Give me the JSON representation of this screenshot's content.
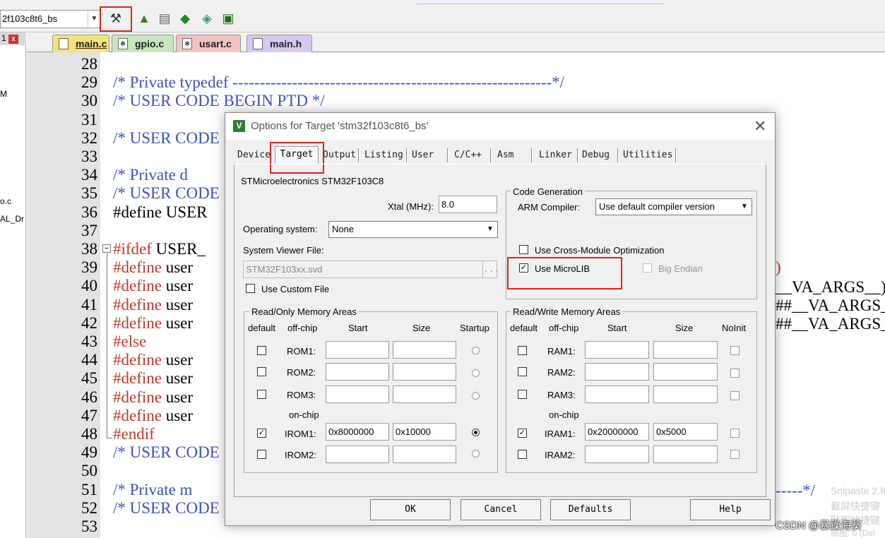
{
  "toolbar": {
    "target_name": "2f103c8t6_bs",
    "icons": [
      "options-for-target-icon",
      "manage-components-icon",
      "select-packs-icon",
      "debug-diamond-icon",
      "download-icon",
      "pack-installer-icon"
    ]
  },
  "left_panel": {
    "close_symbol": "x",
    "items": [
      "1",
      "M",
      "o.c",
      "AL_Dr"
    ]
  },
  "file_tabs": [
    {
      "label": "main.c",
      "active": true,
      "color": "#f6e27a"
    },
    {
      "label": "gpio.c",
      "active": false,
      "color": "#c8e6c0"
    },
    {
      "label": "usart.c",
      "active": false,
      "color": "#f4c2c2"
    },
    {
      "label": "main.h",
      "active": false,
      "color": "#d6c8f0"
    }
  ],
  "editor": {
    "lines": [
      {
        "n": "28",
        "segments": []
      },
      {
        "n": "29",
        "segments": [
          {
            "c": "cm",
            "t": "/* Private typedef -----------------------------------------------------------*/"
          }
        ]
      },
      {
        "n": "30",
        "segments": [
          {
            "c": "cm",
            "t": "/* USER CODE BEGIN PTD */"
          }
        ]
      },
      {
        "n": "31",
        "segments": []
      },
      {
        "n": "32",
        "segments": [
          {
            "c": "cm",
            "t": "/* USER CODE"
          }
        ]
      },
      {
        "n": "33",
        "segments": []
      },
      {
        "n": "34",
        "segments": [
          {
            "c": "cm",
            "t": "/* Private d"
          },
          {
            "c": "cm",
            "t": "                                                            -----*/"
          }
        ]
      },
      {
        "n": "35",
        "segments": [
          {
            "c": "cm",
            "t": "/* USER CODE"
          }
        ]
      },
      {
        "n": "36",
        "segments": [
          {
            "c": "tx",
            "t": "#define USER"
          }
        ]
      },
      {
        "n": "37",
        "segments": []
      },
      {
        "n": "38",
        "segments": [
          {
            "c": "pp",
            "t": "#ifdef"
          },
          {
            "c": "tx",
            "t": " USER_"
          }
        ]
      },
      {
        "n": "39",
        "segments": [
          {
            "c": "pp",
            "t": "#define"
          },
          {
            "c": "tx",
            "t": " user"
          }
        ]
      },
      {
        "n": "40",
        "segments": [
          {
            "c": "pp",
            "t": "#define"
          },
          {
            "c": "tx",
            "t": " user"
          }
        ]
      },
      {
        "n": "41",
        "segments": [
          {
            "c": "pp",
            "t": "#define"
          },
          {
            "c": "tx",
            "t": " user"
          }
        ]
      },
      {
        "n": "42",
        "segments": [
          {
            "c": "pp",
            "t": "#define"
          },
          {
            "c": "tx",
            "t": " user"
          }
        ]
      },
      {
        "n": "43",
        "segments": [
          {
            "c": "pp",
            "t": "#else"
          }
        ]
      },
      {
        "n": "44",
        "segments": [
          {
            "c": "pp",
            "t": "#define"
          },
          {
            "c": "tx",
            "t": " user"
          }
        ]
      },
      {
        "n": "45",
        "segments": [
          {
            "c": "pp",
            "t": "#define"
          },
          {
            "c": "tx",
            "t": " user"
          }
        ]
      },
      {
        "n": "46",
        "segments": [
          {
            "c": "pp",
            "t": "#define"
          },
          {
            "c": "tx",
            "t": " user"
          }
        ]
      },
      {
        "n": "47",
        "segments": [
          {
            "c": "pp",
            "t": "#define"
          },
          {
            "c": "tx",
            "t": " user"
          }
        ]
      },
      {
        "n": "48",
        "segments": [
          {
            "c": "pp",
            "t": "#endif"
          }
        ]
      },
      {
        "n": "49",
        "segments": [
          {
            "c": "cm",
            "t": "/* USER CODE"
          }
        ]
      },
      {
        "n": "50",
        "segments": []
      },
      {
        "n": "51",
        "segments": [
          {
            "c": "cm",
            "t": "/* Private m"
          }
        ]
      },
      {
        "n": "52",
        "segments": [
          {
            "c": "cm",
            "t": "/* USER CODE"
          }
        ]
      },
      {
        "n": "53",
        "segments": []
      }
    ],
    "right_fragments": {
      "paren": ")",
      "va1": "__VA_ARGS__)",
      "va2": "##__VA_ARGS_",
      "va3": "##__VA_ARGS_",
      "end51": "-----*/"
    }
  },
  "dialog": {
    "title": "Options for Target 'stm32f103c8t6_bs'",
    "close": "✕",
    "tabs": [
      "Device",
      "Target",
      "Output",
      "Listing",
      "User",
      "C/C++",
      "Asm",
      "Linker",
      "Debug",
      "Utilities"
    ],
    "active_tab": "Target",
    "device_name": "STMicroelectronics STM32F103C8",
    "xtal_label": "Xtal (MHz):",
    "xtal_value": "8.0",
    "os_label": "Operating system:",
    "os_value": "None",
    "svd_label": "System Viewer File:",
    "svd_value": "STM32F103xx.svd",
    "svd_browse": "...",
    "custom_file_label": "Use Custom File",
    "code_gen": {
      "title": "Code Generation",
      "compiler_label": "ARM Compiler:",
      "compiler_value": "Use default compiler version",
      "cross_module_label": "Use Cross-Module Optimization",
      "microlib_label": "Use MicroLIB",
      "microlib_checked": true,
      "big_endian_label": "Big Endian"
    },
    "ro_memory": {
      "title": "Read/Only Memory Areas",
      "headers": [
        "default",
        "off-chip",
        "Start",
        "Size",
        "Startup"
      ],
      "offchip_rows": [
        {
          "label": "ROM1:",
          "start": "",
          "size": ""
        },
        {
          "label": "ROM2:",
          "start": "",
          "size": ""
        },
        {
          "label": "ROM3:",
          "start": "",
          "size": ""
        }
      ],
      "onchip_label": "on-chip",
      "onchip_rows": [
        {
          "label": "IROM1:",
          "start": "0x8000000",
          "size": "0x10000",
          "default": true,
          "startup": true
        },
        {
          "label": "IROM2:",
          "start": "",
          "size": "",
          "default": false,
          "startup": false
        }
      ]
    },
    "rw_memory": {
      "title": "Read/Write Memory Areas",
      "headers": [
        "default",
        "off-chip",
        "Start",
        "Size",
        "NoInit"
      ],
      "offchip_rows": [
        {
          "label": "RAM1:",
          "start": "",
          "size": ""
        },
        {
          "label": "RAM2:",
          "start": "",
          "size": ""
        },
        {
          "label": "RAM3:",
          "start": "",
          "size": ""
        }
      ],
      "onchip_label": "on-chip",
      "onchip_rows": [
        {
          "label": "IRAM1:",
          "start": "0x20000000",
          "size": "0x5000",
          "default": true
        },
        {
          "label": "IRAM2:",
          "start": "",
          "size": "",
          "default": false
        }
      ]
    },
    "buttons": {
      "ok": "OK",
      "cancel": "Cancel",
      "defaults": "Defaults",
      "help": "Help"
    }
  },
  "watermark": {
    "csdn": "CSDN @暴躁海葵",
    "snipaste": "Snipaste 2.8",
    "shortcut1": "截屏快捷键",
    "shortcut2": "贴图快捷键",
    "pin": "贴图: 0 (Del"
  },
  "colors": {
    "highlight_red": "#e2231a",
    "comment_blue": "#3a52c4",
    "preproc_red": "#c0392b"
  }
}
